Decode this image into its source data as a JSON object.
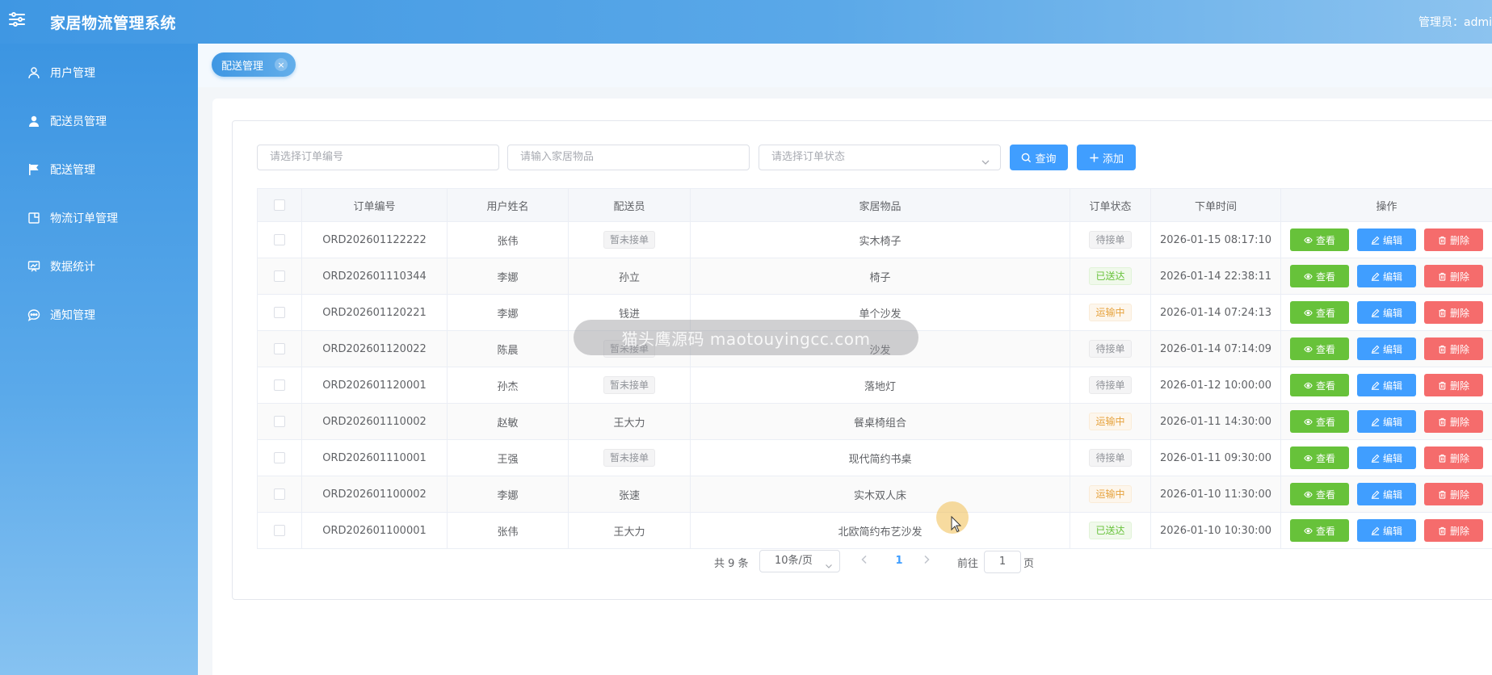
{
  "header": {
    "title": "家居物流管理系统",
    "admin": "管理员：admi"
  },
  "sidebar": {
    "items": [
      {
        "label": "用户管理",
        "icon": "user-icon"
      },
      {
        "label": "配送员管理",
        "icon": "user-filled-icon"
      },
      {
        "label": "配送管理",
        "icon": "flag-icon"
      },
      {
        "label": "物流订单管理",
        "icon": "document-icon"
      },
      {
        "label": "数据统计",
        "icon": "chart-icon"
      },
      {
        "label": "通知管理",
        "icon": "chat-icon"
      }
    ]
  },
  "tabs": [
    {
      "label": "配送管理",
      "close": "×"
    }
  ],
  "filters": {
    "order_no_placeholder": "请选择订单编号",
    "item_placeholder": "请输入家居物品",
    "status_placeholder": "请选择订单状态",
    "search_label": "查询",
    "add_label": "添加"
  },
  "table": {
    "headers": {
      "order_no": "订单编号",
      "user": "用户姓名",
      "courier": "配送员",
      "item": "家居物品",
      "status": "订单状态",
      "time": "下单时间",
      "ops": "操作"
    },
    "rows": [
      {
        "order_no": "ORD202601122222",
        "user": "张伟",
        "courier": "暂未接单",
        "courier_tag": true,
        "item": "实木椅子",
        "status": "待接单",
        "status_type": "info",
        "time": "2026-01-15 08:17:10"
      },
      {
        "order_no": "ORD202601110344",
        "user": "李娜",
        "courier": "孙立",
        "courier_tag": false,
        "item": "椅子",
        "status": "已送达",
        "status_type": "success",
        "time": "2026-01-14 22:38:11"
      },
      {
        "order_no": "ORD202601120221",
        "user": "李娜",
        "courier": "钱进",
        "courier_tag": false,
        "item": "单个沙发",
        "status": "运输中",
        "status_type": "warning",
        "time": "2026-01-14 07:24:13"
      },
      {
        "order_no": "ORD202601120022",
        "user": "陈晨",
        "courier": "暂未接单",
        "courier_tag": true,
        "item": "沙发",
        "status": "待接单",
        "status_type": "info",
        "time": "2026-01-14 07:14:09"
      },
      {
        "order_no": "ORD202601120001",
        "user": "孙杰",
        "courier": "暂未接单",
        "courier_tag": true,
        "item": "落地灯",
        "status": "待接单",
        "status_type": "info",
        "time": "2026-01-12 10:00:00"
      },
      {
        "order_no": "ORD202601110002",
        "user": "赵敏",
        "courier": "王大力",
        "courier_tag": false,
        "item": "餐桌椅组合",
        "status": "运输中",
        "status_type": "warning",
        "time": "2026-01-11 14:30:00"
      },
      {
        "order_no": "ORD202601110001",
        "user": "王强",
        "courier": "暂未接单",
        "courier_tag": true,
        "item": "现代简约书桌",
        "status": "待接单",
        "status_type": "info",
        "time": "2026-01-11 09:30:00"
      },
      {
        "order_no": "ORD202601100002",
        "user": "李娜",
        "courier": "张速",
        "courier_tag": false,
        "item": "实木双人床",
        "status": "运输中",
        "status_type": "warning",
        "time": "2026-01-10 11:30:00"
      },
      {
        "order_no": "ORD202601100001",
        "user": "张伟",
        "courier": "王大力",
        "courier_tag": false,
        "item": "北欧简约布艺沙发",
        "status": "已送达",
        "status_type": "success",
        "time": "2026-01-10 10:30:00"
      }
    ],
    "actions": {
      "view": "查看",
      "edit": "编辑",
      "delete": "删除"
    }
  },
  "pagination": {
    "total": "共 9 条",
    "page_size": "10条/页",
    "current": "1",
    "goto_prefix": "前往",
    "goto_value": "1",
    "goto_suffix": "页"
  },
  "watermark": "猫头鹰源码 maotouyingcc.com",
  "colors": {
    "primary": "#409eff",
    "success": "#67c23a",
    "danger": "#f56c6c",
    "warning": "#e6a23c",
    "header_start": "#3f97e3"
  }
}
